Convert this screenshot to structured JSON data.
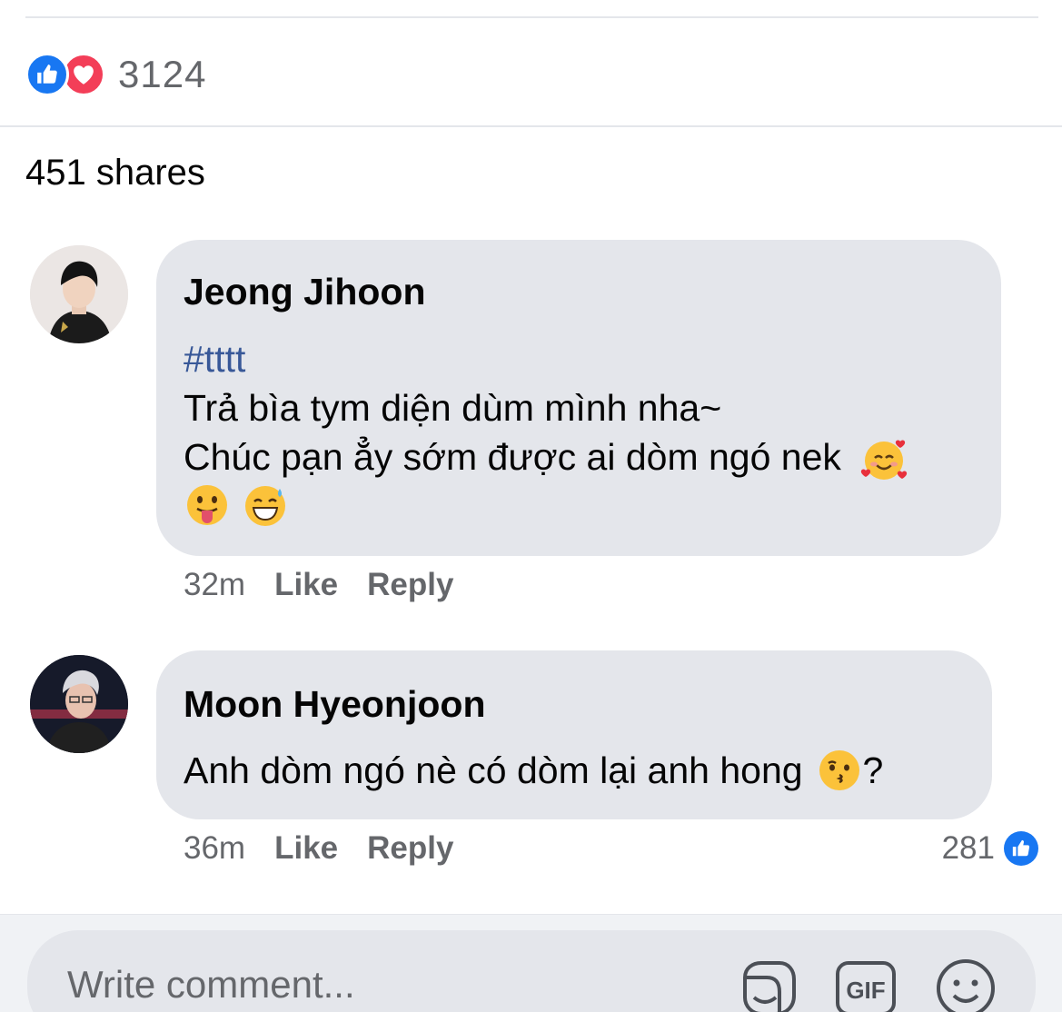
{
  "post": {
    "reaction_count": "3124",
    "shares_text": "451 shares"
  },
  "comments": [
    {
      "author": "Jeong Jihoon",
      "hashtag": "#tttt",
      "line1": "Trả bìa tym diện dùm mình nha~",
      "line2": "Chúc pạn ẳy sớm được ai dòm ngó nek",
      "emojis": [
        "smiling-face-with-hearts",
        "face-with-tongue",
        "grinning-face-with-sweat"
      ],
      "time": "32m",
      "like_label": "Like",
      "reply_label": "Reply"
    },
    {
      "author": "Moon Hyeonjoon",
      "text": "Anh dòm ngó nè có dòm lại anh hong",
      "text_suffix": "?",
      "emojis": [
        "kissing-face"
      ],
      "time": "36m",
      "like_label": "Like",
      "reply_label": "Reply",
      "reaction_count": "281"
    }
  ],
  "composer": {
    "placeholder": "Write comment..."
  },
  "icons": {
    "like": "like-icon",
    "love": "love-icon",
    "sticker": "sticker-icon",
    "gif": "gif-icon",
    "emoji": "emoji-icon"
  },
  "colors": {
    "like_blue": "#1877f2",
    "love_red": "#f33e58",
    "hashtag_blue": "#385898",
    "bubble_gray": "#e4e6eb",
    "meta_gray": "#65676b"
  }
}
